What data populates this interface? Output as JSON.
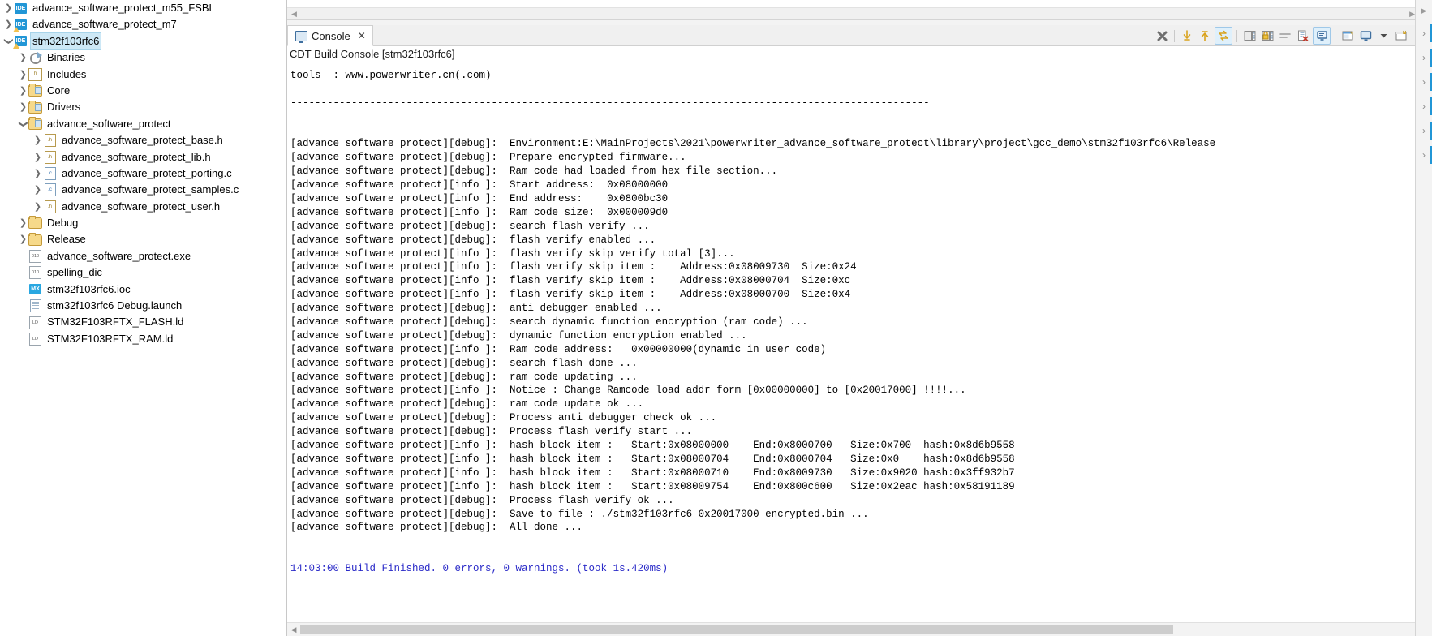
{
  "explorer": {
    "items": [
      {
        "label": "advance_software_protect_m55_FSBL",
        "level": 0,
        "twisty": "collapsed",
        "icon": "ide-project-icon",
        "selected": false,
        "warn": false
      },
      {
        "label": "advance_software_protect_m7",
        "level": 0,
        "twisty": "collapsed",
        "icon": "ide-project-icon",
        "selected": false,
        "warn": true
      },
      {
        "label": "stm32f103rfc6",
        "level": 0,
        "twisty": "expanded",
        "icon": "ide-project-icon",
        "selected": true,
        "warn": true
      },
      {
        "label": "Binaries",
        "level": 1,
        "twisty": "collapsed",
        "icon": "binaries-icon",
        "selected": false,
        "warn": false
      },
      {
        "label": "Includes",
        "level": 1,
        "twisty": "collapsed",
        "icon": "includes-icon",
        "selected": false,
        "warn": false
      },
      {
        "label": "Core",
        "level": 1,
        "twisty": "collapsed",
        "icon": "source-folder-icon",
        "selected": false,
        "warn": false
      },
      {
        "label": "Drivers",
        "level": 1,
        "twisty": "collapsed",
        "icon": "source-folder-icon",
        "selected": false,
        "warn": false
      },
      {
        "label": "advance_software_protect",
        "level": 1,
        "twisty": "expanded",
        "icon": "source-folder-icon",
        "selected": false,
        "warn": false
      },
      {
        "label": "advance_software_protect_base.h",
        "level": 2,
        "twisty": "collapsed",
        "icon": "header-file-icon",
        "selected": false,
        "warn": false
      },
      {
        "label": "advance_software_protect_lib.h",
        "level": 2,
        "twisty": "collapsed",
        "icon": "header-file-icon",
        "selected": false,
        "warn": false
      },
      {
        "label": "advance_software_protect_porting.c",
        "level": 2,
        "twisty": "collapsed",
        "icon": "c-file-icon",
        "selected": false,
        "warn": false
      },
      {
        "label": "advance_software_protect_samples.c",
        "level": 2,
        "twisty": "collapsed",
        "icon": "c-file-icon",
        "selected": false,
        "warn": false
      },
      {
        "label": "advance_software_protect_user.h",
        "level": 2,
        "twisty": "collapsed",
        "icon": "header-file-icon",
        "selected": false,
        "warn": false
      },
      {
        "label": "Debug",
        "level": 1,
        "twisty": "collapsed",
        "icon": "folder-icon",
        "selected": false,
        "warn": false
      },
      {
        "label": "Release",
        "level": 1,
        "twisty": "collapsed",
        "icon": "folder-icon",
        "selected": false,
        "warn": false
      },
      {
        "label": "advance_software_protect.exe",
        "level": 1,
        "twisty": "none",
        "icon": "binary-file-icon",
        "selected": false,
        "warn": false
      },
      {
        "label": "spelling_dic",
        "level": 1,
        "twisty": "none",
        "icon": "binary-file-icon",
        "selected": false,
        "warn": false
      },
      {
        "label": "stm32f103rfc6.ioc",
        "level": 1,
        "twisty": "none",
        "icon": "cubemx-file-icon",
        "selected": false,
        "warn": false
      },
      {
        "label": "stm32f103rfc6 Debug.launch",
        "level": 1,
        "twisty": "none",
        "icon": "launch-file-icon",
        "selected": false,
        "warn": false
      },
      {
        "label": "STM32F103RFTX_FLASH.ld",
        "level": 1,
        "twisty": "none",
        "icon": "linker-script-icon",
        "selected": false,
        "warn": false
      },
      {
        "label": "STM32F103RFTX_RAM.ld",
        "level": 1,
        "twisty": "none",
        "icon": "linker-script-icon",
        "selected": false,
        "warn": false
      }
    ]
  },
  "console": {
    "tab_label": "Console",
    "tab_close_glyph": "✕",
    "title": "CDT Build Console [stm32f103rfc6]",
    "toolbar": [
      {
        "name": "terminate-button",
        "glyph": "✖",
        "active": false
      },
      {
        "name": "scroll-down-button",
        "glyph": "⇩",
        "active": false
      },
      {
        "name": "scroll-up-button",
        "glyph": "⇧",
        "active": false
      },
      {
        "name": "toggle-console-button",
        "glyph": "⇄",
        "active": true
      },
      {
        "name": "save-console-button",
        "glyph": "▤",
        "active": false
      },
      {
        "name": "lock-console-button",
        "glyph": "⚿",
        "active": false
      },
      {
        "name": "word-wrap-button",
        "glyph": "≡",
        "active": false
      },
      {
        "name": "clear-console-button",
        "glyph": "⌧",
        "active": false
      },
      {
        "name": "scroll-lock-button",
        "glyph": "⬚",
        "active": true
      },
      {
        "name": "pin-console-button",
        "glyph": "◰",
        "active": false
      },
      {
        "name": "display-console-button",
        "glyph": "☐",
        "active": false
      },
      {
        "name": "display-console-dropdown",
        "glyph": "▼",
        "active": false
      },
      {
        "name": "open-console-button",
        "glyph": "⊞",
        "active": false
      },
      {
        "name": "open-console-dropdown",
        "glyph": "▼",
        "active": false
      }
    ],
    "lines": [
      {
        "text": "tools  : www.powerwriter.cn(.com)",
        "style": "plain"
      },
      {
        "text": "",
        "style": "plain"
      },
      {
        "text": "---------------------------------------------------------------------------------------------------------",
        "style": "plain"
      },
      {
        "text": "",
        "style": "plain"
      },
      {
        "text": "",
        "style": "plain"
      },
      {
        "text": "[advance software protect][debug]:  Environment:E:\\MainProjects\\2021\\powerwriter_advance_software_protect\\library\\project\\gcc_demo\\stm32f103rfc6\\Release",
        "style": "plain"
      },
      {
        "text": "[advance software protect][debug]:  Prepare encrypted firmware...",
        "style": "plain"
      },
      {
        "text": "[advance software protect][debug]:  Ram code had loaded from hex file section...",
        "style": "plain"
      },
      {
        "text": "[advance software protect][info ]:  Start address:  0x08000000",
        "style": "plain"
      },
      {
        "text": "[advance software protect][info ]:  End address:    0x0800bc30",
        "style": "plain"
      },
      {
        "text": "[advance software protect][info ]:  Ram code size:  0x000009d0",
        "style": "plain"
      },
      {
        "text": "[advance software protect][debug]:  search flash verify ...",
        "style": "plain"
      },
      {
        "text": "[advance software protect][debug]:  flash verify enabled ...",
        "style": "plain"
      },
      {
        "text": "[advance software protect][info ]:  flash verify skip verify total [3]...",
        "style": "plain"
      },
      {
        "text": "[advance software protect][info ]:  flash verify skip item :    Address:0x08009730  Size:0x24",
        "style": "plain"
      },
      {
        "text": "[advance software protect][info ]:  flash verify skip item :    Address:0x08000704  Size:0xc",
        "style": "plain"
      },
      {
        "text": "[advance software protect][info ]:  flash verify skip item :    Address:0x08000700  Size:0x4",
        "style": "plain"
      },
      {
        "text": "[advance software protect][debug]:  anti debugger enabled ...",
        "style": "plain"
      },
      {
        "text": "[advance software protect][debug]:  search dynamic function encryption (ram code) ...",
        "style": "plain"
      },
      {
        "text": "[advance software protect][debug]:  dynamic function encryption enabled ...",
        "style": "plain"
      },
      {
        "text": "[advance software protect][info ]:  Ram code address:   0x00000000(dynamic in user code)",
        "style": "plain"
      },
      {
        "text": "[advance software protect][debug]:  search flash done ...",
        "style": "plain"
      },
      {
        "text": "[advance software protect][debug]:  ram code updating ...",
        "style": "plain"
      },
      {
        "text": "[advance software protect][info ]:  Notice : Change Ramcode load addr form [0x00000000] to [0x20017000] !!!!...",
        "style": "plain"
      },
      {
        "text": "[advance software protect][debug]:  ram code update ok ...",
        "style": "plain"
      },
      {
        "text": "[advance software protect][debug]:  Process anti debugger check ok ...",
        "style": "plain"
      },
      {
        "text": "[advance software protect][debug]:  Process flash verify start ...",
        "style": "plain"
      },
      {
        "text": "[advance software protect][info ]:  hash block item :   Start:0x08000000    End:0x8000700   Size:0x700  hash:0x8d6b9558",
        "style": "plain"
      },
      {
        "text": "[advance software protect][info ]:  hash block item :   Start:0x08000704    End:0x8000704   Size:0x0    hash:0x8d6b9558",
        "style": "plain"
      },
      {
        "text": "[advance software protect][info ]:  hash block item :   Start:0x08000710    End:0x8009730   Size:0x9020 hash:0x3ff932b7",
        "style": "plain"
      },
      {
        "text": "[advance software protect][info ]:  hash block item :   Start:0x08009754    End:0x800c600   Size:0x2eac hash:0x58191189",
        "style": "plain"
      },
      {
        "text": "[advance software protect][debug]:  Process flash verify ok ...",
        "style": "plain"
      },
      {
        "text": "[advance software protect][debug]:  Save to file : ./stm32f103rfc6_0x20017000_encrypted.bin ...",
        "style": "plain"
      },
      {
        "text": "[advance software protect][debug]:  All done ...",
        "style": "plain"
      },
      {
        "text": "",
        "style": "plain"
      },
      {
        "text": "",
        "style": "plain"
      },
      {
        "text": "14:03:00 Build Finished. 0 errors, 0 warnings. (took 1s.420ms)",
        "style": "finish"
      }
    ]
  },
  "scrollbars": {
    "left_arrow": "◀",
    "right_arrow": "▶",
    "up_arrow": "▲",
    "down_arrow": "▼"
  },
  "farright": {
    "items": [
      {
        "name": "fast-view-1",
        "glyph": "›"
      },
      {
        "name": "fast-view-2",
        "glyph": "›"
      },
      {
        "name": "fast-view-3",
        "glyph": "›"
      },
      {
        "name": "fast-view-4",
        "glyph": "›"
      },
      {
        "name": "fast-view-5",
        "glyph": "›"
      },
      {
        "name": "fast-view-6",
        "glyph": "›"
      }
    ]
  },
  "colors": {
    "selection": "#cde8f6",
    "accent": "#2196d6",
    "build_finished_text": "#2b2bc8"
  }
}
